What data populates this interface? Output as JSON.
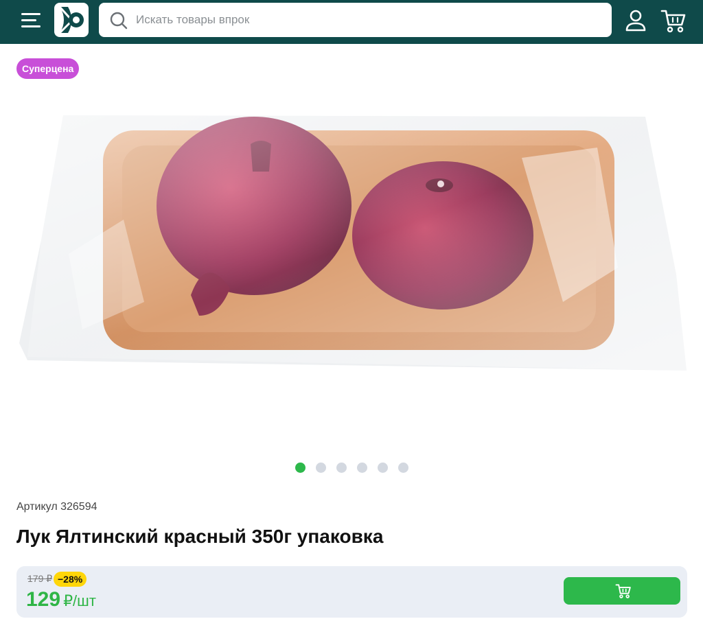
{
  "header": {
    "search_placeholder": "Искать товары впрок"
  },
  "product": {
    "badge": "Суперцена",
    "sku": "Артикул 326594",
    "title": "Лук Ялтинский красный 350г упаковка",
    "gallery": {
      "image_count": 6,
      "active_index": 0
    }
  },
  "pricing": {
    "old_price": "179 ₽",
    "discount": "−28%",
    "price": "129",
    "unit": "₽/шт"
  },
  "colors": {
    "header_bg": "#0f4a4a",
    "accent_green": "#2db84b",
    "badge_purple": "#c84fd8",
    "discount_yellow": "#ffd60a"
  }
}
